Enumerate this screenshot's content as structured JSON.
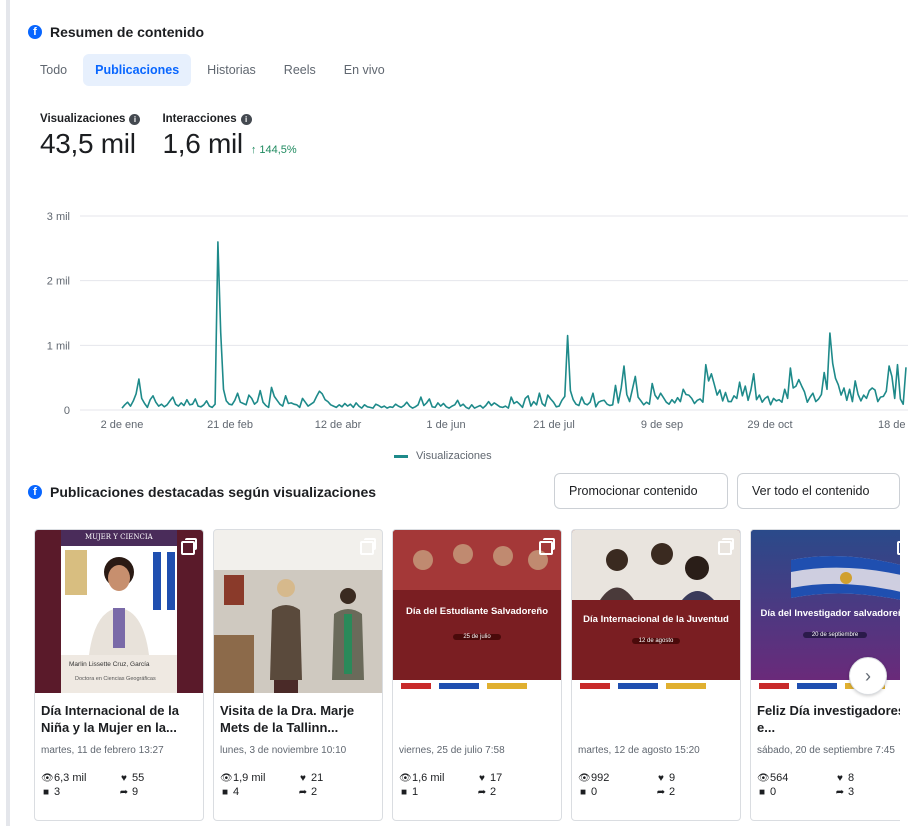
{
  "summary": {
    "title": "Resumen de contenido",
    "tabs": [
      {
        "label": "Todo",
        "active": false
      },
      {
        "label": "Publicaciones",
        "active": true
      },
      {
        "label": "Historias",
        "active": false
      },
      {
        "label": "Reels",
        "active": false
      },
      {
        "label": "En vivo",
        "active": false
      }
    ],
    "metrics": {
      "views": {
        "label": "Visualizaciones",
        "value": "43,5 mil"
      },
      "interactions": {
        "label": "Interacciones",
        "value": "1,6 mil",
        "delta": "144,5%"
      }
    }
  },
  "chart_data": {
    "type": "line",
    "title": "",
    "xlabel": "",
    "ylabel": "",
    "y_ticks": [
      "0",
      "1 mil",
      "2 mil",
      "3 mil"
    ],
    "ylim": [
      0,
      3000
    ],
    "x_tick_labels": [
      "2 de ene",
      "21 de feb",
      "12 de abr",
      "1 de jun",
      "21 de jul",
      "9 de sep",
      "29 de oct",
      "18 de"
    ],
    "grid": true,
    "legend_position": "bottom",
    "accent_color": "#1e8a8a",
    "series": [
      {
        "name": "Visualizaciones",
        "values": [
          30,
          80,
          120,
          60,
          140,
          250,
          480,
          180,
          100,
          40,
          160,
          220,
          120,
          60,
          90,
          50,
          80,
          140,
          200,
          90,
          60,
          110,
          70,
          160,
          80,
          90,
          170,
          60,
          50,
          80,
          140,
          60,
          40,
          90,
          2600,
          1200,
          320,
          140,
          90,
          80,
          150,
          260,
          120,
          100,
          80,
          230,
          180,
          90,
          130,
          300,
          120,
          70,
          40,
          350,
          210,
          150,
          90,
          60,
          220,
          100,
          110,
          90,
          80,
          40,
          180,
          120,
          60,
          90,
          120,
          210,
          290,
          250,
          160,
          130,
          80,
          60,
          40,
          80,
          50,
          100,
          60,
          90,
          40,
          110,
          60,
          30,
          80,
          50,
          40,
          30,
          90,
          70,
          40,
          60,
          30,
          50,
          40,
          90,
          60,
          40,
          70,
          120,
          60,
          30,
          50,
          80,
          200,
          70,
          110,
          170,
          50,
          40,
          110,
          60,
          100,
          50,
          30,
          60,
          80,
          150,
          60,
          90,
          40,
          20,
          80,
          30,
          50,
          70,
          30,
          70,
          130,
          70,
          110,
          80,
          50,
          40,
          60,
          30,
          200,
          100,
          130,
          90,
          40,
          180,
          220,
          60,
          130,
          80,
          260,
          100,
          60,
          230,
          170,
          120,
          50,
          60,
          150,
          210,
          1150,
          300,
          160,
          90,
          70,
          200,
          100,
          80,
          120,
          260,
          50,
          120,
          140,
          150,
          90,
          70,
          80,
          380,
          110,
          340,
          680,
          240,
          130,
          320,
          520,
          200,
          140,
          80,
          120,
          90,
          410,
          230,
          170,
          260,
          190,
          120,
          90,
          160,
          110,
          190,
          130,
          320,
          240,
          230,
          180,
          100,
          150,
          170,
          120,
          700,
          450,
          560,
          400,
          230,
          310,
          140,
          270,
          130,
          130,
          220,
          180,
          430,
          220,
          370,
          150,
          310,
          560,
          160,
          230,
          120,
          180,
          210,
          80,
          180,
          140,
          160,
          120,
          320,
          180,
          650,
          340,
          370,
          470,
          370,
          280,
          120,
          200,
          260,
          130,
          170,
          240,
          580,
          320,
          1190,
          720,
          490,
          390,
          230,
          340,
          150,
          320,
          130,
          450,
          240,
          140,
          230,
          180,
          300,
          340,
          310,
          130,
          200,
          210,
          290,
          680,
          520,
          180,
          700,
          170,
          90,
          660
        ]
      }
    ]
  },
  "featured": {
    "title": "Publicaciones destacadas según visualizaciones",
    "promote_label": "Promocionar contenido",
    "view_all_label": "Ver todo el contenido",
    "posts": [
      {
        "title": "Día Internacional de la Niña y la Mujer en la...",
        "date": "martes, 11 de febrero 13:27",
        "views": "6,3 mil",
        "likes": "55",
        "comments": "3",
        "shares": "9",
        "thumb_top": "MUJER Y CIENCIA",
        "thumb_bottom": "Marlin Lissette Cruz, García",
        "thumb_sub": "Doctora en Ciencias Geográficas"
      },
      {
        "title": "Visita de la Dra. Marje Mets de la Tallinn...",
        "date": "lunes, 3 de noviembre 10:10",
        "views": "1,9 mil",
        "likes": "21",
        "comments": "4",
        "shares": "2"
      },
      {
        "title": "",
        "date": "viernes, 25 de julio 7:58",
        "views": "1,6 mil",
        "likes": "17",
        "comments": "1",
        "shares": "2",
        "thumb_text": "Día del Estudiante Salvadoreño",
        "thumb_date": "25 de julio"
      },
      {
        "title": "",
        "date": "martes, 12 de agosto 15:20",
        "views": "992",
        "likes": "9",
        "comments": "0",
        "shares": "2",
        "thumb_text": "Día Internacional de la Juventud",
        "thumb_date": "12 de agosto"
      },
      {
        "title": "Feliz Día investigadores e...",
        "date": "sábado, 20 de septiembre 7:45",
        "views": "564",
        "likes": "8",
        "comments": "0",
        "shares": "3",
        "thumb_text": "Día del Investigador salvadoreño",
        "thumb_date": "20 de septiembre"
      }
    ]
  }
}
